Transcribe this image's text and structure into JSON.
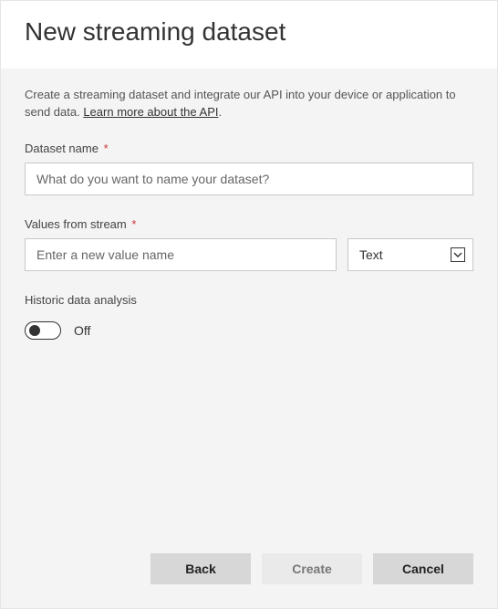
{
  "header": {
    "title": "New streaming dataset"
  },
  "description": {
    "text_before_link": "Create a streaming dataset and integrate our API into your device or application to send data. ",
    "link_text": "Learn more about the API",
    "text_after_link": "."
  },
  "fields": {
    "dataset_name": {
      "label": "Dataset name",
      "required_mark": "*",
      "placeholder": "What do you want to name your dataset?",
      "value": ""
    },
    "values_from_stream": {
      "label": "Values from stream",
      "required_mark": "*",
      "placeholder": "Enter a new value name",
      "value": "",
      "type_selected": "Text"
    },
    "historic": {
      "label": "Historic data analysis",
      "state_text": "Off"
    }
  },
  "footer": {
    "back": "Back",
    "create": "Create",
    "cancel": "Cancel"
  }
}
